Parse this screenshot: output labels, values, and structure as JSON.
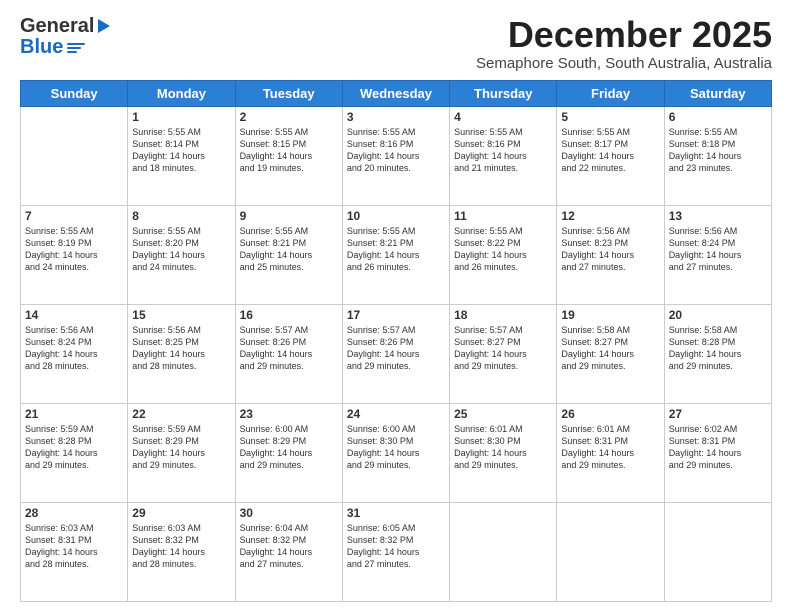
{
  "header": {
    "logo_general": "General",
    "logo_blue": "Blue",
    "month_title": "December 2025",
    "subtitle": "Semaphore South, South Australia, Australia"
  },
  "calendar": {
    "weekdays": [
      "Sunday",
      "Monday",
      "Tuesday",
      "Wednesday",
      "Thursday",
      "Friday",
      "Saturday"
    ],
    "weeks": [
      [
        {
          "day": "",
          "info": ""
        },
        {
          "day": "1",
          "info": "Sunrise: 5:55 AM\nSunset: 8:14 PM\nDaylight: 14 hours\nand 18 minutes."
        },
        {
          "day": "2",
          "info": "Sunrise: 5:55 AM\nSunset: 8:15 PM\nDaylight: 14 hours\nand 19 minutes."
        },
        {
          "day": "3",
          "info": "Sunrise: 5:55 AM\nSunset: 8:16 PM\nDaylight: 14 hours\nand 20 minutes."
        },
        {
          "day": "4",
          "info": "Sunrise: 5:55 AM\nSunset: 8:16 PM\nDaylight: 14 hours\nand 21 minutes."
        },
        {
          "day": "5",
          "info": "Sunrise: 5:55 AM\nSunset: 8:17 PM\nDaylight: 14 hours\nand 22 minutes."
        },
        {
          "day": "6",
          "info": "Sunrise: 5:55 AM\nSunset: 8:18 PM\nDaylight: 14 hours\nand 23 minutes."
        }
      ],
      [
        {
          "day": "7",
          "info": "Sunrise: 5:55 AM\nSunset: 8:19 PM\nDaylight: 14 hours\nand 24 minutes."
        },
        {
          "day": "8",
          "info": "Sunrise: 5:55 AM\nSunset: 8:20 PM\nDaylight: 14 hours\nand 24 minutes."
        },
        {
          "day": "9",
          "info": "Sunrise: 5:55 AM\nSunset: 8:21 PM\nDaylight: 14 hours\nand 25 minutes."
        },
        {
          "day": "10",
          "info": "Sunrise: 5:55 AM\nSunset: 8:21 PM\nDaylight: 14 hours\nand 26 minutes."
        },
        {
          "day": "11",
          "info": "Sunrise: 5:55 AM\nSunset: 8:22 PM\nDaylight: 14 hours\nand 26 minutes."
        },
        {
          "day": "12",
          "info": "Sunrise: 5:56 AM\nSunset: 8:23 PM\nDaylight: 14 hours\nand 27 minutes."
        },
        {
          "day": "13",
          "info": "Sunrise: 5:56 AM\nSunset: 8:24 PM\nDaylight: 14 hours\nand 27 minutes."
        }
      ],
      [
        {
          "day": "14",
          "info": "Sunrise: 5:56 AM\nSunset: 8:24 PM\nDaylight: 14 hours\nand 28 minutes."
        },
        {
          "day": "15",
          "info": "Sunrise: 5:56 AM\nSunset: 8:25 PM\nDaylight: 14 hours\nand 28 minutes."
        },
        {
          "day": "16",
          "info": "Sunrise: 5:57 AM\nSunset: 8:26 PM\nDaylight: 14 hours\nand 29 minutes."
        },
        {
          "day": "17",
          "info": "Sunrise: 5:57 AM\nSunset: 8:26 PM\nDaylight: 14 hours\nand 29 minutes."
        },
        {
          "day": "18",
          "info": "Sunrise: 5:57 AM\nSunset: 8:27 PM\nDaylight: 14 hours\nand 29 minutes."
        },
        {
          "day": "19",
          "info": "Sunrise: 5:58 AM\nSunset: 8:27 PM\nDaylight: 14 hours\nand 29 minutes."
        },
        {
          "day": "20",
          "info": "Sunrise: 5:58 AM\nSunset: 8:28 PM\nDaylight: 14 hours\nand 29 minutes."
        }
      ],
      [
        {
          "day": "21",
          "info": "Sunrise: 5:59 AM\nSunset: 8:28 PM\nDaylight: 14 hours\nand 29 minutes."
        },
        {
          "day": "22",
          "info": "Sunrise: 5:59 AM\nSunset: 8:29 PM\nDaylight: 14 hours\nand 29 minutes."
        },
        {
          "day": "23",
          "info": "Sunrise: 6:00 AM\nSunset: 8:29 PM\nDaylight: 14 hours\nand 29 minutes."
        },
        {
          "day": "24",
          "info": "Sunrise: 6:00 AM\nSunset: 8:30 PM\nDaylight: 14 hours\nand 29 minutes."
        },
        {
          "day": "25",
          "info": "Sunrise: 6:01 AM\nSunset: 8:30 PM\nDaylight: 14 hours\nand 29 minutes."
        },
        {
          "day": "26",
          "info": "Sunrise: 6:01 AM\nSunset: 8:31 PM\nDaylight: 14 hours\nand 29 minutes."
        },
        {
          "day": "27",
          "info": "Sunrise: 6:02 AM\nSunset: 8:31 PM\nDaylight: 14 hours\nand 29 minutes."
        }
      ],
      [
        {
          "day": "28",
          "info": "Sunrise: 6:03 AM\nSunset: 8:31 PM\nDaylight: 14 hours\nand 28 minutes."
        },
        {
          "day": "29",
          "info": "Sunrise: 6:03 AM\nSunset: 8:32 PM\nDaylight: 14 hours\nand 28 minutes."
        },
        {
          "day": "30",
          "info": "Sunrise: 6:04 AM\nSunset: 8:32 PM\nDaylight: 14 hours\nand 27 minutes."
        },
        {
          "day": "31",
          "info": "Sunrise: 6:05 AM\nSunset: 8:32 PM\nDaylight: 14 hours\nand 27 minutes."
        },
        {
          "day": "",
          "info": ""
        },
        {
          "day": "",
          "info": ""
        },
        {
          "day": "",
          "info": ""
        }
      ]
    ]
  }
}
